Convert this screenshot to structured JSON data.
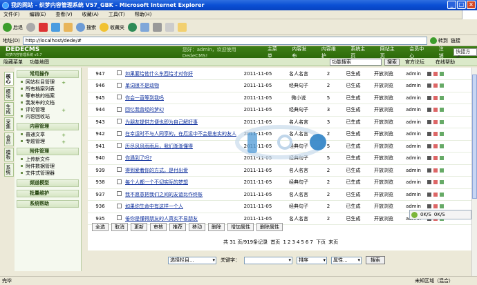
{
  "window": {
    "title": "我的网站 - 织梦内容管理系统 V57_GBK - Microsoft Internet Explorer"
  },
  "menu": [
    "文件(F)",
    "编辑(E)",
    "查看(V)",
    "收藏(A)",
    "工具(T)",
    "帮助(H)"
  ],
  "toolbar": {
    "back": "后退",
    "search": "搜索",
    "favorites": "收藏夹"
  },
  "address": {
    "label": "地址(D)",
    "value": "http://localhost/dede/#",
    "go": "转到",
    "links": "链接"
  },
  "cms": {
    "logo": "DEDECMS",
    "logo_sub": "织梦内容管理系统",
    "version": "v5.7",
    "welcome": "您好：admin，欢迎使用DedeCMS!",
    "nav": [
      "主菜单",
      "内容发布",
      "内容维护",
      "系统主页",
      "网站主页",
      "会员中心",
      "注销"
    ],
    "style": "快捷方式",
    "sub": [
      "隐藏菜单",
      "功能地图"
    ],
    "func_map": "功能搜索",
    "search": "搜索",
    "forum": "官方论坛",
    "help": "在线帮助"
  },
  "vtabs": [
    "核心",
    "模块",
    "生成",
    "采集",
    "会员",
    "模板",
    "系统"
  ],
  "leftmenu": [
    {
      "title": "常用操作",
      "items": [
        "网站栏目管理",
        "所有档案列表",
        "等审核的档案",
        "我发布的文档",
        "评论管理",
        "内容回收站"
      ]
    },
    {
      "title": "内容管理",
      "items": [
        "普通文章",
        "专题管理"
      ]
    },
    {
      "title": "附件管理",
      "items": [
        "上传新文件",
        "附件数据管理",
        "文件式管理器"
      ]
    },
    {
      "title": "频道模型",
      "items": []
    },
    {
      "title": "批量维护",
      "items": []
    },
    {
      "title": "系统帮助",
      "items": []
    }
  ],
  "rows": [
    {
      "id": "947",
      "title": "如果要给他什么东西给才对你好",
      "date": "2011-11-05",
      "cat": "名人名言",
      "n": "2",
      "state": "已生成",
      "pub": "开放浏览",
      "user": "admin"
    },
    {
      "id": "946",
      "title": "单词很不是动物",
      "date": "2011-11-05",
      "cat": "经典句子",
      "n": "2",
      "state": "已生成",
      "pub": "开放浏览",
      "user": "admin"
    },
    {
      "id": "945",
      "title": "你会一直等到我吗",
      "date": "2011-11-05",
      "cat": "微小说",
      "n": "5",
      "state": "已生成",
      "pub": "开放浏览",
      "user": "admin"
    },
    {
      "id": "944",
      "title": "回忆我曾经的梦幻",
      "date": "2011-11-05",
      "cat": "经典句子",
      "n": "3",
      "state": "已生成",
      "pub": "开放浏览",
      "user": "admin"
    },
    {
      "id": "943",
      "title": "为朋友提供方便也即为自己解好事",
      "date": "2011-11-05",
      "cat": "名人名言",
      "n": "3",
      "state": "已生成",
      "pub": "开放浏览",
      "user": "admin"
    },
    {
      "id": "942",
      "title": "在幸运时不与人同享的，在厄运中不会是忠实的友人",
      "date": "2011-11-05",
      "cat": "名人名言",
      "n": "2",
      "state": "已生成",
      "pub": "开放浏览",
      "user": "admin"
    },
    {
      "id": "941",
      "title": "历尽风风雨雨后，我们渐渐懂得",
      "date": "2011-11-05",
      "cat": "经典句子",
      "n": "5",
      "state": "已生成",
      "pub": "开放浏览",
      "user": "admin"
    },
    {
      "id": "940",
      "title": "你遇到了吗?",
      "date": "2011-11-05",
      "cat": "经典句子",
      "n": "5",
      "state": "已生成",
      "pub": "开放浏览",
      "user": "admin"
    },
    {
      "id": "939",
      "title": "得到爱着你的方式，是付出爱",
      "date": "2011-11-05",
      "cat": "名人名言",
      "n": "2",
      "state": "已生成",
      "pub": "开放浏览",
      "user": "admin"
    },
    {
      "id": "938",
      "title": "每个人都一个不切实际的梦想",
      "date": "2011-11-05",
      "cat": "经典句子",
      "n": "2",
      "state": "已生成",
      "pub": "开放浏览",
      "user": "admin"
    },
    {
      "id": "937",
      "title": "我不愿意把我们之间的友谊比作终账",
      "date": "2011-11-05",
      "cat": "名人名言",
      "n": "2",
      "state": "已生成",
      "pub": "开放浏览",
      "user": "admin"
    },
    {
      "id": "936",
      "title": "如果你生命中有这样一个人",
      "date": "2011-11-05",
      "cat": "经典句子",
      "n": "2",
      "state": "已生成",
      "pub": "开放浏览",
      "user": "admin"
    },
    {
      "id": "935",
      "title": "倦你是懂得朋友的人真实不易朋友",
      "date": "2011-11-05",
      "cat": "名人名言",
      "n": "2",
      "state": "已生成",
      "pub": "开放浏览",
      "user": "admin"
    }
  ],
  "actions": [
    "全选",
    "取消",
    "更新",
    "审核",
    "推荐",
    "移动",
    "删除",
    "增加属性",
    "删除属性"
  ],
  "pager": {
    "info": "共 31 页/919条记录",
    "first": "首页",
    "pages": [
      "1",
      "2",
      "3",
      "4",
      "5",
      "6",
      "7"
    ],
    "next": "下页",
    "last": "末页"
  },
  "filter": {
    "cat": "选择栏目...",
    "kw_label": "关键字：",
    "sort": "排序",
    "attr": "属性...",
    "btn": "搜索"
  },
  "speed": {
    "up": "0K/S",
    "down": "0K/S"
  },
  "status": {
    "left": "完毕",
    "right": "未知区域（混合）"
  }
}
